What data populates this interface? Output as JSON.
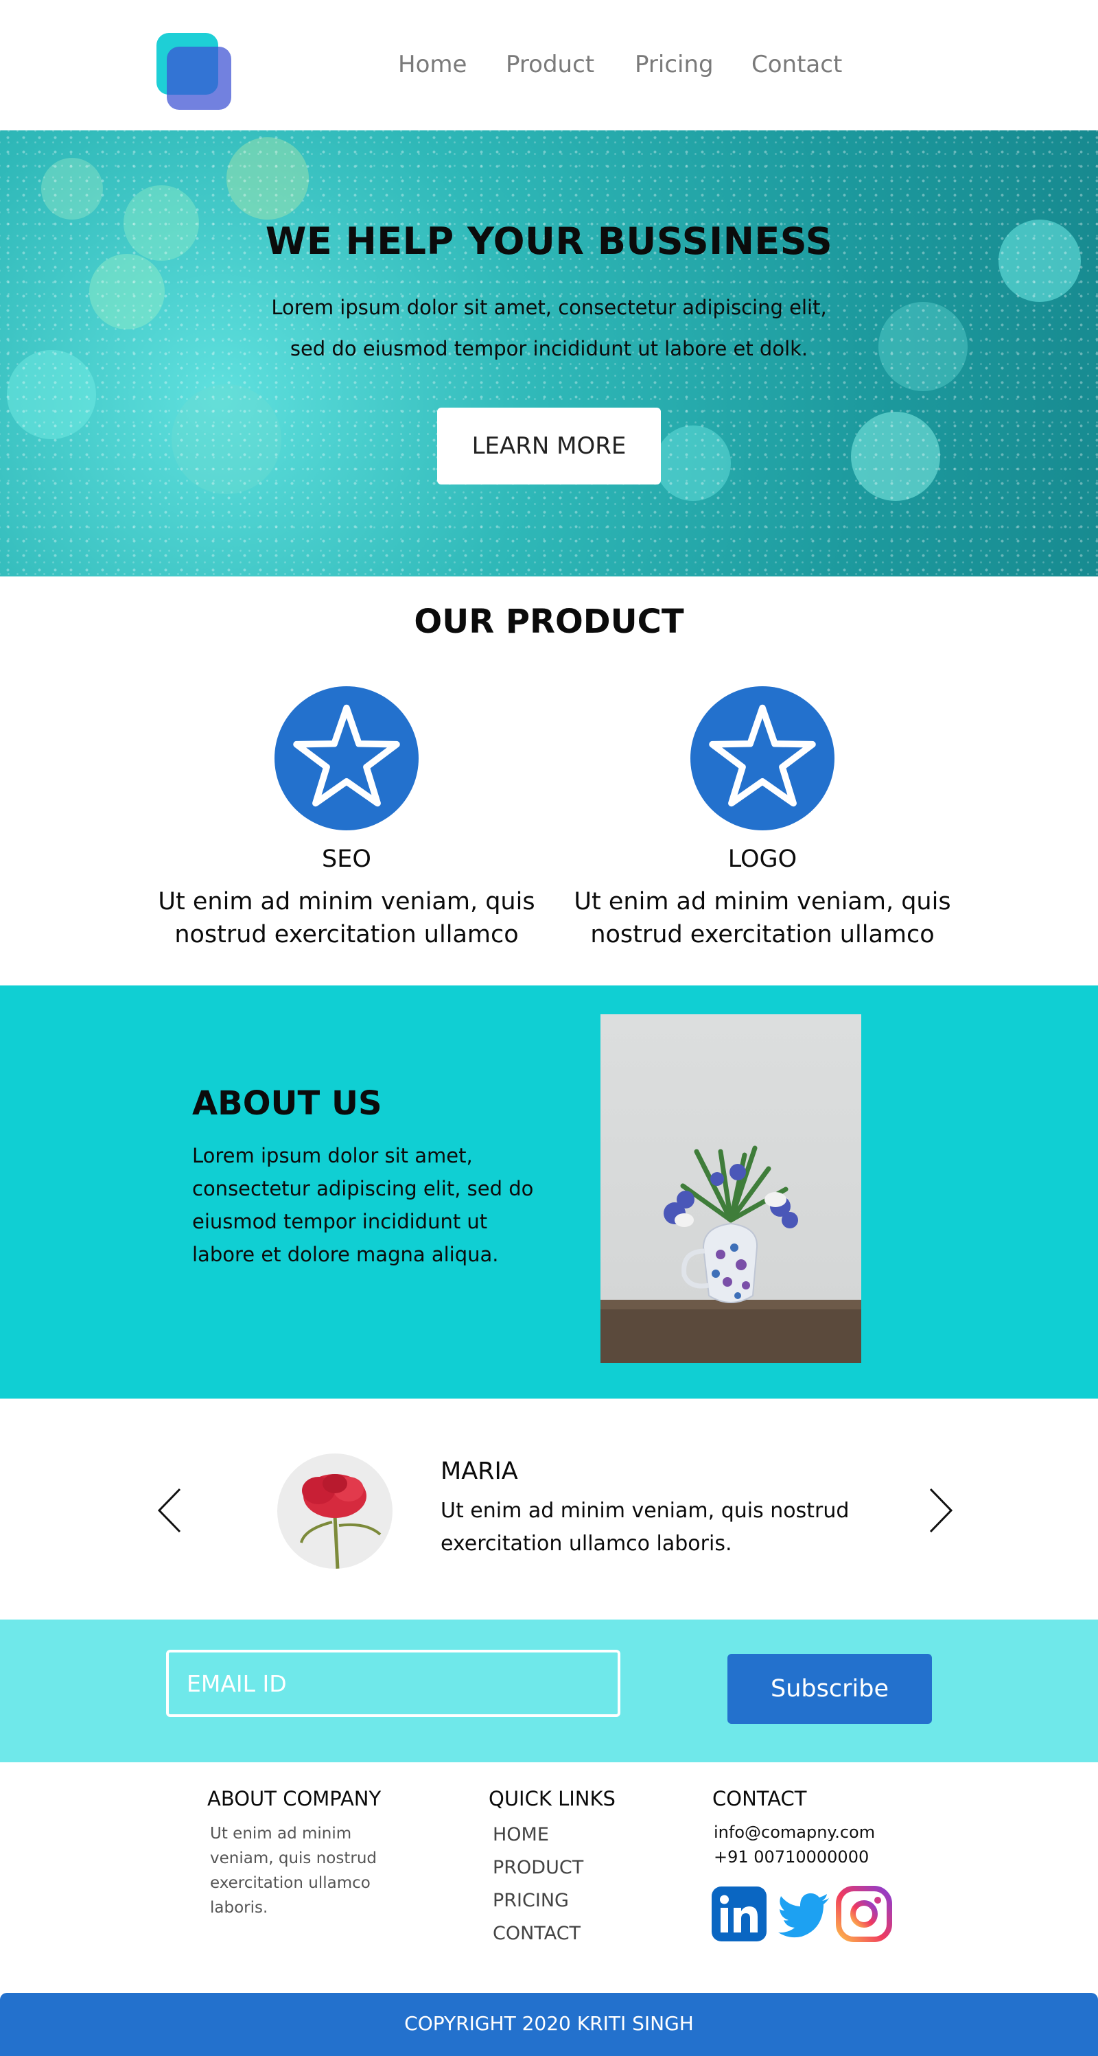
{
  "nav": {
    "items": [
      {
        "label": "Home"
      },
      {
        "label": "Product"
      },
      {
        "label": "Pricing"
      },
      {
        "label": "Contact"
      }
    ]
  },
  "hero": {
    "title": "WE HELP YOUR BUSSINESS",
    "text": "Lorem ipsum dolor sit amet, consectetur adipiscing elit, sed do eiusmod tempor incididunt ut labore et dolk.",
    "button_label": "LEARN MORE"
  },
  "product": {
    "title": "OUR PRODUCT",
    "cards": [
      {
        "title": "SEO",
        "text": "Ut enim ad minim veniam, quis nostrud exercitation ullamco",
        "icon": "star-icon"
      },
      {
        "title": "LOGO",
        "text": "Ut enim ad minim veniam, quis nostrud exercitation ullamco",
        "icon": "star-icon"
      }
    ]
  },
  "about": {
    "title": "ABOUT US",
    "text": "Lorem ipsum dolor sit amet, consectetur adipiscing elit, sed do eiusmod tempor incididunt ut labore et dolore magna aliqua."
  },
  "testimonial": {
    "name": "MARIA",
    "text": "Ut enim ad minim veniam, quis nostrud exercitation ullamco laboris."
  },
  "subscribe": {
    "email_placeholder": "EMAIL ID",
    "button_label": "Subscribe"
  },
  "footer": {
    "about_heading": "ABOUT COMPANY",
    "about_text": "Ut enim ad minim veniam, quis nostrud exercitation ullamco laboris.",
    "links_heading": "QUICK LINKS",
    "links": [
      {
        "label": "HOME"
      },
      {
        "label": "PRODUCT"
      },
      {
        "label": "PRICING"
      },
      {
        "label": "CONTACT"
      }
    ],
    "contact_heading": "CONTACT",
    "email": "info@comapny.com",
    "phone": "+91 00710000000",
    "social": [
      "linkedin-icon",
      "twitter-icon",
      "instagram-icon"
    ]
  },
  "copyright": "COPYRIGHT 2020 KRITI SINGH",
  "colors": {
    "primary_blue": "#2371cd",
    "teal": "#10cfd3",
    "light_teal": "#6fe8ea"
  }
}
